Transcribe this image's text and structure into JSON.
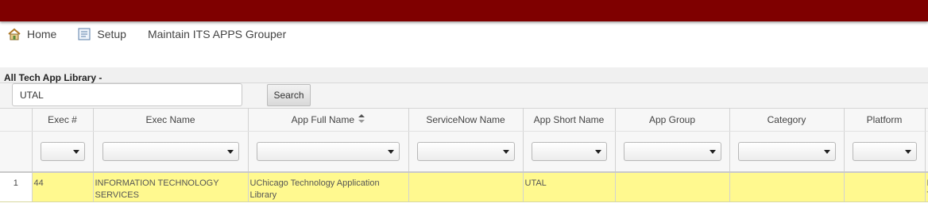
{
  "nav": {
    "home_label": "Home",
    "setup_label": "Setup",
    "maintain_label": "Maintain ITS APPS Grouper"
  },
  "section": {
    "title": "All Tech App Library -"
  },
  "search": {
    "value": "UTAL",
    "button_label": "Search"
  },
  "table": {
    "columns": [
      {
        "key": "exec_num",
        "label": "Exec #"
      },
      {
        "key": "exec_name",
        "label": "Exec Name"
      },
      {
        "key": "app_full_name",
        "label": "App Full Name",
        "sorted": true
      },
      {
        "key": "servicenow_name",
        "label": "ServiceNow Name"
      },
      {
        "key": "app_short_name",
        "label": "App Short Name"
      },
      {
        "key": "app_group",
        "label": "App Group"
      },
      {
        "key": "category",
        "label": "Category"
      },
      {
        "key": "platform",
        "label": "Platform"
      }
    ],
    "rows": [
      {
        "row_number": "1",
        "exec_num": "44",
        "exec_name": "INFORMATION TECHNOLOGY SERVICES",
        "app_full_name": "UChicago Technology Application Library",
        "servicenow_name": "",
        "app_short_name": "UTAL",
        "app_group": "",
        "category": "",
        "platform": "",
        "extra_partial": "I T"
      }
    ]
  },
  "colors": {
    "topbar": "#7f0000",
    "row_highlight": "#fff98f"
  },
  "icons": {
    "home": "home-icon",
    "setup": "setup-icon",
    "sort": "sort-icon"
  }
}
